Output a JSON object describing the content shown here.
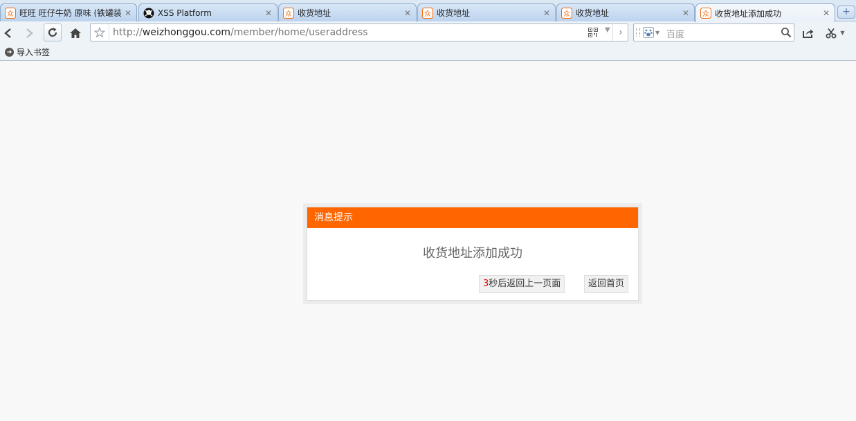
{
  "tabs": [
    {
      "title": "旺旺 旺仔牛奶 原味 (铁罐装(",
      "favicon": "zhong-orange-icon",
      "active": false
    },
    {
      "title": "XSS Platform",
      "favicon": "pirate-skull-icon",
      "active": false
    },
    {
      "title": "收货地址",
      "favicon": "zhong-orange-icon",
      "active": false
    },
    {
      "title": "收货地址",
      "favicon": "zhong-orange-icon",
      "active": false
    },
    {
      "title": "收货地址",
      "favicon": "zhong-orange-icon",
      "active": false
    },
    {
      "title": "收货地址添加成功",
      "favicon": "zhong-orange-icon",
      "active": true
    }
  ],
  "toolbar": {
    "url_scheme": "http://",
    "url_host": "weizhonggou.com",
    "url_path": "/member/home/useraddress",
    "search_placeholder": "百度"
  },
  "bookmarks": {
    "import_label": "导入书签"
  },
  "dialog": {
    "header": "消息提示",
    "message": "收货地址添加成功",
    "countdown": "3",
    "back_label": "秒后返回上一页面",
    "home_label": "返回首页"
  },
  "colors": {
    "accent": "#ff6600",
    "background": "#f8f8f8",
    "countdown": "#ee0000"
  }
}
